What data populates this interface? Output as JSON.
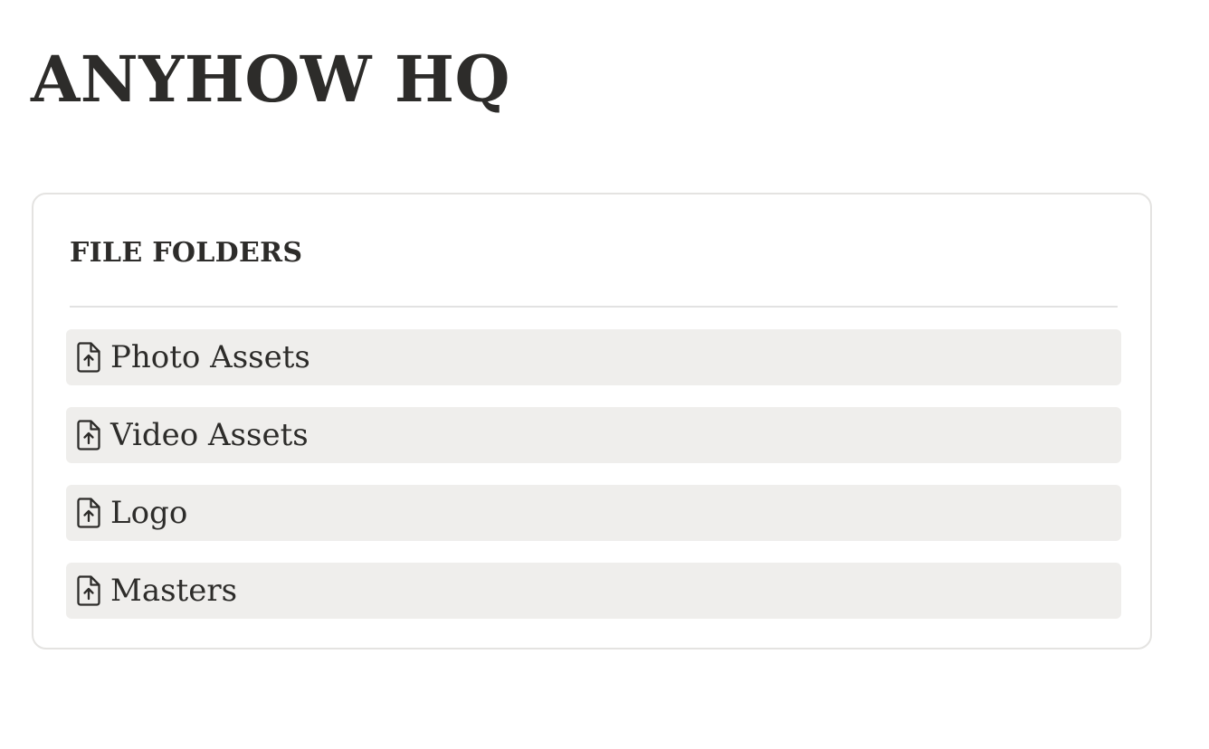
{
  "header": {
    "title": "ANYHOW HQ"
  },
  "file_folders": {
    "heading": "FILE FOLDERS",
    "items": [
      {
        "label": "Photo Assets",
        "icon": "file-upload-icon"
      },
      {
        "label": "Video Assets",
        "icon": "file-upload-icon"
      },
      {
        "label": "Logo",
        "icon": "file-upload-icon"
      },
      {
        "label": "Masters",
        "icon": "file-upload-icon"
      }
    ]
  },
  "colors": {
    "text": "#2d2c2a",
    "item_background": "#efeeec",
    "card_border": "#e4e3e1"
  }
}
